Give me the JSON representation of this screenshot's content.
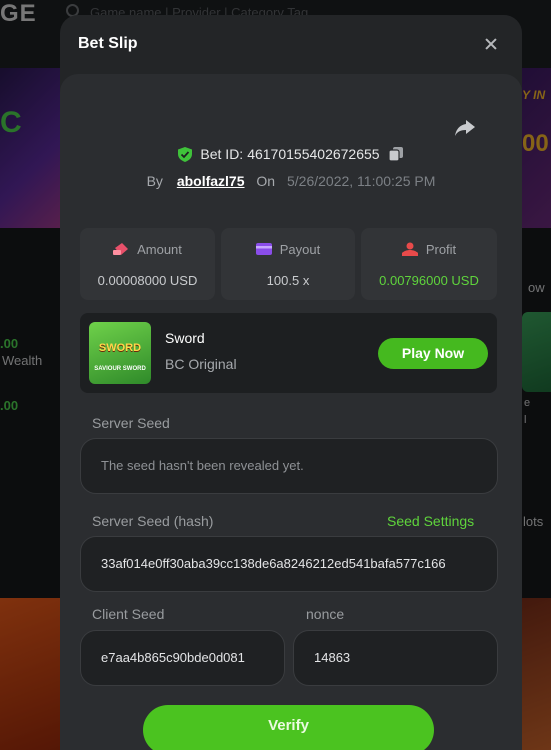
{
  "background": {
    "logo_fragment": "GE",
    "search_placeholder": "Game name | Provider | Category Tag",
    "banner_left_text": "C",
    "banner_right_line1": "Y IN",
    "banner_right_line2": "00",
    "left_amount_1": ".00",
    "left_label_1": "Wealth",
    "left_amount_2": ".00",
    "right_label_1": "ow",
    "right_label_2": "e",
    "right_label_3": "l",
    "right_label_4": "lots"
  },
  "modal": {
    "title": "Bet Slip",
    "bet_id_label": "Bet ID:",
    "bet_id": "46170155402672655",
    "by_label": "By",
    "username": "abolfazl75",
    "on_label": "On",
    "date": "5/26/2022, 11:00:25 PM",
    "stats": [
      {
        "label": "Amount",
        "value": "0.00008000 USD"
      },
      {
        "label": "Payout",
        "value": "100.5 x"
      },
      {
        "label": "Profit",
        "value": "0.00796000 USD"
      }
    ],
    "game": {
      "name": "Sword",
      "provider": "BC Original",
      "thumb_title": "SWORD",
      "thumb_subtitle": "SAVIOUR SWORD",
      "play_label": "Play Now"
    },
    "server_seed_label": "Server Seed",
    "server_seed_value": "The seed hasn't been revealed yet.",
    "server_seed_hash_label": "Server Seed (hash)",
    "seed_settings_label": "Seed Settings",
    "server_seed_hash": "33af014e0ff30aba39cc138de6a8246212ed541bafa577c166",
    "client_seed_label": "Client Seed",
    "client_seed": "e7aa4b865c90bde0d081",
    "nonce_label": "nonce",
    "nonce": "14863",
    "verify_label": "Verify"
  },
  "colors": {
    "accent_green": "#5fd43c",
    "button_green": "#45b91f",
    "shield_green": "#3fc23a",
    "amount_icon": "#e8506a",
    "payout_icon": "#8a4dea",
    "profit_icon": "#e84a4a"
  },
  "icons": {
    "close": "close-icon",
    "share": "share-icon",
    "shield": "shield-check-icon",
    "copy": "copy-icon",
    "amount": "coins-icon",
    "payout": "wallet-icon",
    "profit": "profit-icon",
    "search": "search-icon"
  }
}
